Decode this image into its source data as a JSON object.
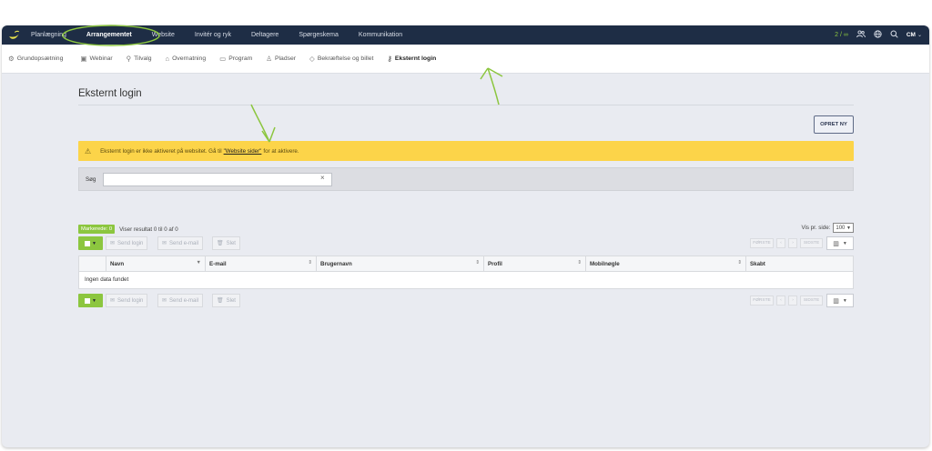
{
  "topnav": {
    "items": [
      "Planlægning",
      "Arrangementet",
      "Website",
      "Invitér og ryk",
      "Deltagere",
      "Spørgeskema",
      "Kommunikation"
    ],
    "active_index": 1,
    "count": "2 / ∞",
    "user": "CM",
    "icons": [
      "people-icon",
      "globe-icon",
      "search-icon",
      "chevron-down-icon"
    ]
  },
  "subnav": {
    "items": [
      {
        "label": "Grundopsætning",
        "icon": "gear-icon"
      },
      {
        "label": "Webinar",
        "icon": "video-icon"
      },
      {
        "label": "Tilvalg",
        "icon": "addon-icon"
      },
      {
        "label": "Overnatning",
        "icon": "bed-icon"
      },
      {
        "label": "Program",
        "icon": "calendar-icon"
      },
      {
        "label": "Pladser",
        "icon": "seat-icon"
      },
      {
        "label": "Bekræftelse og billet",
        "icon": "ticket-icon"
      },
      {
        "label": "Eksternt login",
        "icon": "key-icon"
      }
    ],
    "active_index": 7
  },
  "page": {
    "title": "Eksternt login",
    "create_button": "OPRET NY"
  },
  "warning": {
    "text_before": "Eksternt login er ikke aktiveret på websitet. Gå til",
    "link": "\"Website sider\"",
    "text_after": "for at aktivere."
  },
  "search": {
    "label": "Søg",
    "value": ""
  },
  "status": {
    "marked": "Markerede: 0",
    "showing": "Viser resultat 0 til 0 af 0",
    "per_page_label": "Vis pr. side:",
    "per_page_value": "100"
  },
  "actions": {
    "send_login": "Send login",
    "send_email": "Send e-mail",
    "delete": "Slet"
  },
  "pager": {
    "first": "FØRSTE",
    "prev": "‹",
    "next": "›",
    "last": "SIDSTE"
  },
  "table": {
    "columns": [
      "Navn",
      "E-mail",
      "Brugernavn",
      "Profil",
      "Mobilnøgle",
      "Skabt"
    ],
    "empty_text": "Ingen data fundet"
  },
  "colors": {
    "topbar": "#1e2d45",
    "accent_green": "#8cc63f",
    "warning_yellow": "#fcd449",
    "annotation_green": "#8cc63f"
  }
}
